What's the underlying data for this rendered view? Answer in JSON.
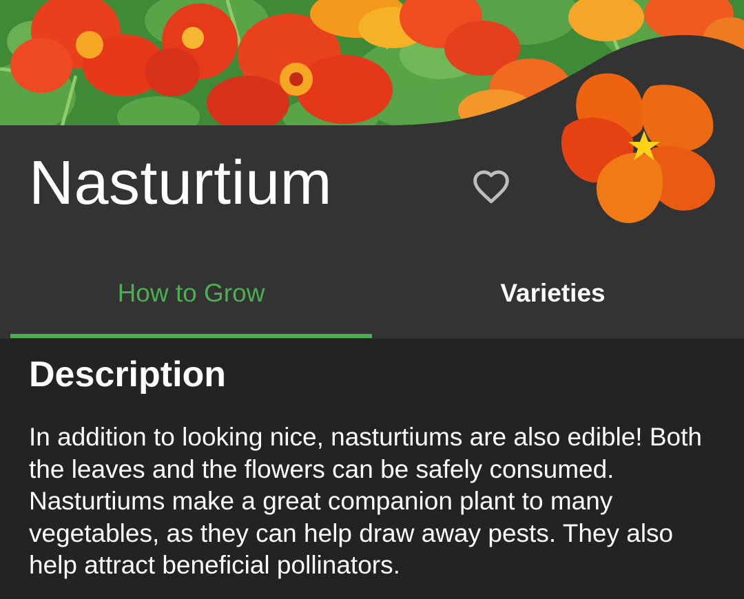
{
  "plant": {
    "name": "Nasturtium"
  },
  "favorite": {
    "icon": "heart-outline-icon",
    "color": "#bdbdbd"
  },
  "logo": {
    "icon": "nasturtium-flower-icon"
  },
  "tabs": [
    {
      "label": "How to Grow",
      "selected": true
    },
    {
      "label": "Varieties",
      "selected": false
    }
  ],
  "content": {
    "heading": "Description",
    "body": "In addition to looking nice, nasturtiums are also edible! Both the leaves and the flowers can be safely consumed. Nasturtiums make a great companion plant to many vegetables, as they can help draw away pests. They also help attract beneficial pollinators."
  },
  "colors": {
    "accent": "#4caf50",
    "header_background": "#333333",
    "content_background": "#232323",
    "text_primary": "#ffffff",
    "flower_orange": "#f36b0f"
  }
}
